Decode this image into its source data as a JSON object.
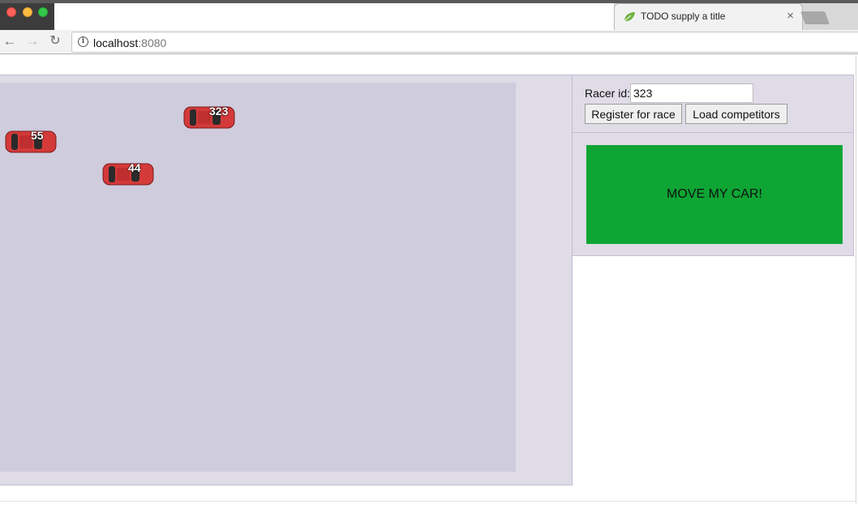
{
  "browser": {
    "tab_title": "TODO supply a title",
    "url_host": "localhost",
    "url_port": ":8080"
  },
  "race": {
    "cars": [
      {
        "label": "323"
      },
      {
        "label": "55"
      },
      {
        "label": "44"
      }
    ]
  },
  "controls": {
    "racer_id_label": "Racer id:",
    "racer_id_value": "323",
    "register_label": "Register for race",
    "load_label": "Load competitors",
    "move_label": "MOVE MY CAR!"
  },
  "colors": {
    "track": "#cfccdd",
    "panel": "#dfdbe7",
    "move_button": "#0ea534",
    "car_body": "#d43a3a"
  }
}
